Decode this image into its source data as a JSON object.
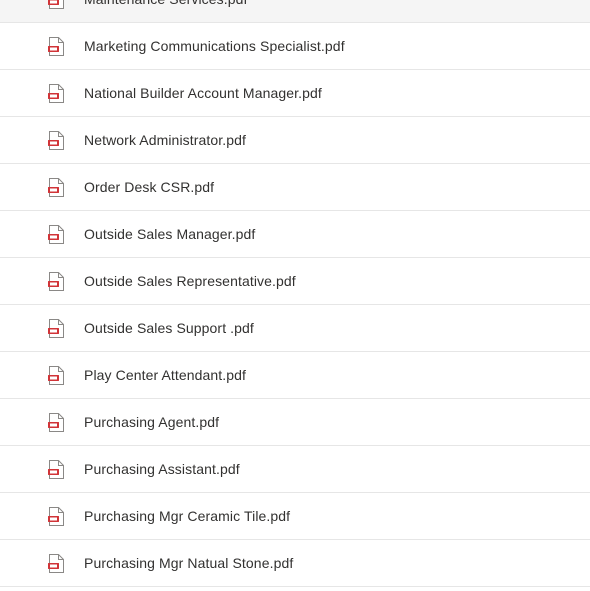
{
  "files": [
    {
      "name": "Maintenance Services.pdf",
      "icon": "pdf-file-icon"
    },
    {
      "name": "Marketing Communications Specialist.pdf",
      "icon": "pdf-file-icon"
    },
    {
      "name": "National Builder Account Manager.pdf",
      "icon": "pdf-file-icon"
    },
    {
      "name": "Network Administrator.pdf",
      "icon": "pdf-file-icon"
    },
    {
      "name": "Order Desk CSR.pdf",
      "icon": "pdf-file-icon"
    },
    {
      "name": "Outside Sales Manager.pdf",
      "icon": "pdf-file-icon"
    },
    {
      "name": "Outside Sales Representative.pdf",
      "icon": "pdf-file-icon"
    },
    {
      "name": "Outside Sales Support .pdf",
      "icon": "pdf-file-icon"
    },
    {
      "name": "Play Center Attendant.pdf",
      "icon": "pdf-file-icon"
    },
    {
      "name": "Purchasing Agent.pdf",
      "icon": "pdf-file-icon"
    },
    {
      "name": "Purchasing Assistant.pdf",
      "icon": "pdf-file-icon"
    },
    {
      "name": "Purchasing Mgr Ceramic Tile.pdf",
      "icon": "pdf-file-icon"
    },
    {
      "name": "Purchasing Mgr Natual Stone.pdf",
      "icon": "pdf-file-icon"
    }
  ],
  "colors": {
    "pdf_accent": "#d13438",
    "text": "#323130",
    "divider": "#e6e6e6"
  }
}
